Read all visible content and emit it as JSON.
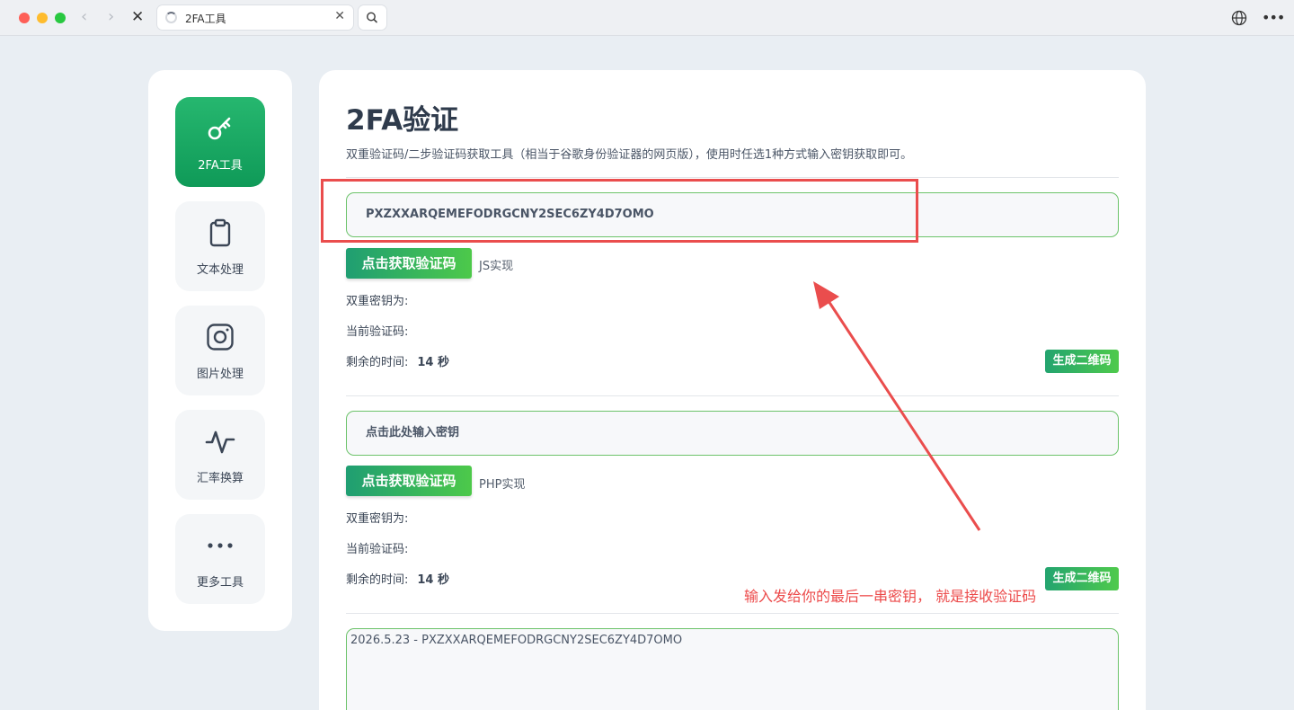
{
  "browser": {
    "tab_title": "2FA工具"
  },
  "sidebar": {
    "items": [
      {
        "label": "2FA工具",
        "icon": "key-icon",
        "active": true
      },
      {
        "label": "文本处理",
        "icon": "clipboard-icon",
        "active": false
      },
      {
        "label": "图片处理",
        "icon": "instagram-icon",
        "active": false
      },
      {
        "label": "汇率换算",
        "icon": "activity-icon",
        "active": false
      },
      {
        "label": "更多工具",
        "icon": "more-icon",
        "active": false
      }
    ]
  },
  "main": {
    "title": "2FA验证",
    "description": "双重验证码/二步验证码获取工具（相当于谷歌身份验证器的网页版），使用时任选1种方式输入密钥获取即可。",
    "sections": [
      {
        "input_value": "PXZXXARQEMEFODRGCNY2SEC6ZY4D7OMO",
        "button_label": "点击获取验证码",
        "impl": "JS实现",
        "secret_label": "双重密钥为:",
        "code_label": "当前验证码:",
        "time_label": "剩余的时间:",
        "time_value": "14 秒",
        "qr_button": "生成二维码"
      },
      {
        "input_value": "点击此处输入密钥",
        "button_label": "点击获取验证码",
        "impl": "PHP实现",
        "secret_label": "双重密钥为:",
        "code_label": "当前验证码:",
        "time_label": "剩余的时间:",
        "time_value": "14 秒",
        "qr_button": "生成二维码"
      }
    ],
    "result_text": "2026.5.23 - PXZXXARQEMEFODRGCNY2SEC6ZY4D7OMO"
  },
  "annotation": {
    "text": "输入发给你的最后一串密钥， 就是接收验证码",
    "color": "#ea4d4d"
  },
  "colors": {
    "accent_green": "#1f9e72",
    "input_border": "#6cc36a"
  }
}
